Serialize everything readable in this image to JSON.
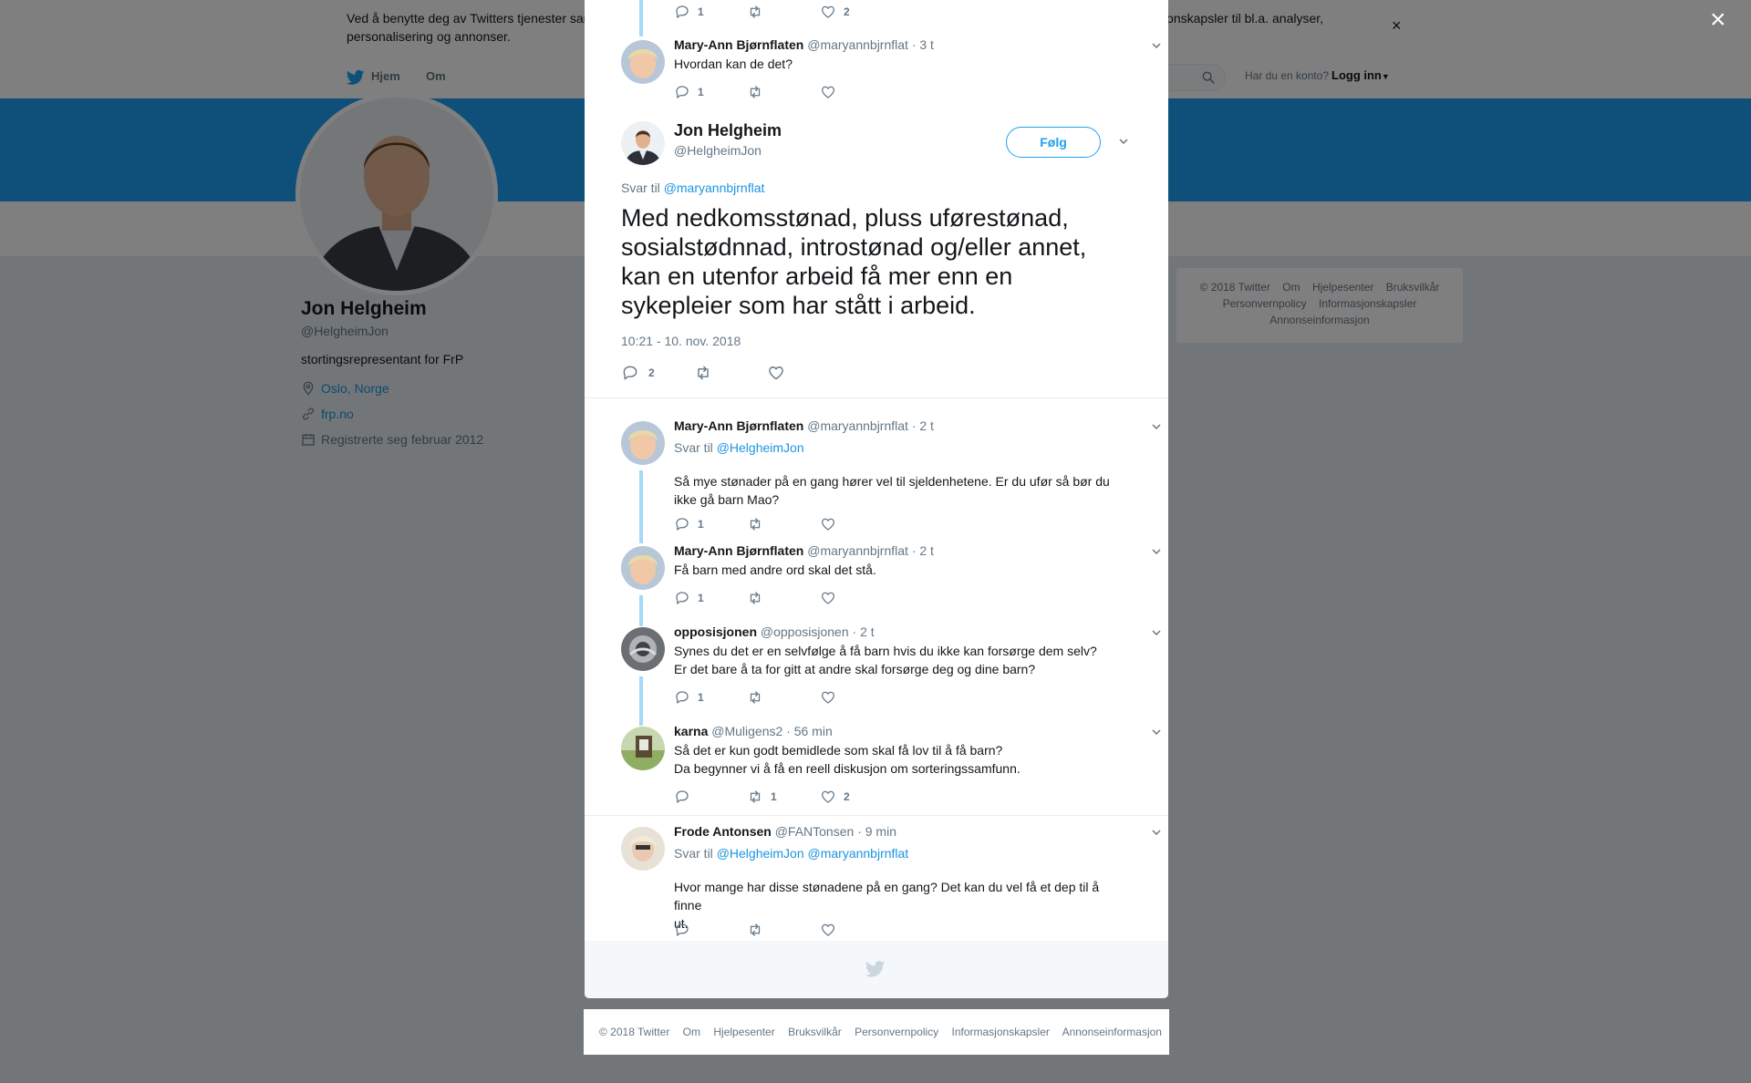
{
  "cookie": {
    "text": "Ved å benytte deg av Twitters tjenester samtykker du i vår bruk av informasjonskapsler. Vi og våre partnere opererer globalt og benytter informasjonskapsler til bl.a. analyser, personalisering og annonser.",
    "close": "×"
  },
  "nav": {
    "home": "Hjem",
    "about": "Om",
    "account_prompt": "Har du en konto?",
    "login": "Logg inn"
  },
  "profile": {
    "name": "Jon Helgheim",
    "handle": "@HelgheimJon",
    "bio": "stortingsrepresentant for FrP",
    "location": "Oslo, Norge",
    "website": "frp.no",
    "joined": "Registrerte seg februar 2012"
  },
  "right_footer": [
    "© 2018 Twitter",
    "Om",
    "Hjelpesenter",
    "Bruksvilkår",
    "Personvernpolicy",
    "Informasjonskapsler",
    "Annonseinformasjon"
  ],
  "overlay_close": "×",
  "top_partial": {
    "reply_count": "1",
    "like_count": "2"
  },
  "tweet_before": {
    "name": "Mary-Ann Bjørnflaten",
    "handle": "@maryannbjrnflat",
    "time": "· 3 t",
    "text": "Hvordan kan de det?",
    "reply_count": "1"
  },
  "main_tweet": {
    "name": "Jon Helgheim",
    "handle": "@HelgheimJon",
    "follow": "Følg",
    "reply_prefix": "Svar til",
    "reply_to": "@maryannbjrnflat",
    "text": "Med nedkomsstønad, pluss uførestønad, sosialstødnnad, introstønad og/eller annet, kan en utenfor arbeid få mer enn en sykepleier som har stått i arbeid.",
    "timestamp": "10:21 - 10. nov. 2018",
    "reply_count": "2"
  },
  "replies": [
    {
      "name": "Mary-Ann Bjørnflaten",
      "handle": "@maryannbjrnflat",
      "time": "· 2 t",
      "reply_prefix": "Svar til",
      "reply_to": "@HelgheimJon",
      "line1": "Så mye stønader på en gang hører vel til sjeldenhetene. Er du ufør så bør du",
      "line2": "ikke gå barn Mao?",
      "reply_count": "1"
    },
    {
      "name": "Mary-Ann Bjørnflaten",
      "handle": "@maryannbjrnflat",
      "time": "· 2 t",
      "line1": "Få barn med andre ord skal det stå.",
      "reply_count": "1"
    },
    {
      "name": "opposisjonen",
      "handle": "@opposisjonen",
      "time": "· 2 t",
      "line1": "Synes du det er en selvfølge å få barn hvis du ikke kan forsørge dem selv?",
      "line2": "Er det bare å ta for gitt at andre skal forsørge deg og dine barn?",
      "reply_count": "1"
    },
    {
      "name": "karna",
      "handle": "@Muligens2",
      "time": "· 56 min",
      "line1": "Så det er kun godt bemidlede som skal få lov til å få barn?",
      "line2": "Da begynner vi å få en reell diskusjon om sorteringssamfunn.",
      "retweet_count": "1",
      "like_count": "2"
    },
    {
      "name": "Frode Antonsen",
      "handle": "@FANTonsen",
      "time": "· 9 min",
      "reply_prefix": "Svar til",
      "reply_to": "@HelgheimJon @maryannbjrnflat",
      "line1": "Hvor mange har disse stønadene på en gang? Det kan du vel få et dep til å finne",
      "line2": "ut."
    }
  ],
  "bottom_footer": [
    "© 2018 Twitter",
    "Om",
    "Hjelpesenter",
    "Bruksvilkår",
    "Personvernpolicy",
    "Informasjonskapsler",
    "Annonseinformasjon"
  ],
  "colors": {
    "brand": "#1da1f2",
    "link": "#1b95e0",
    "thread": "#a4d9f9"
  }
}
